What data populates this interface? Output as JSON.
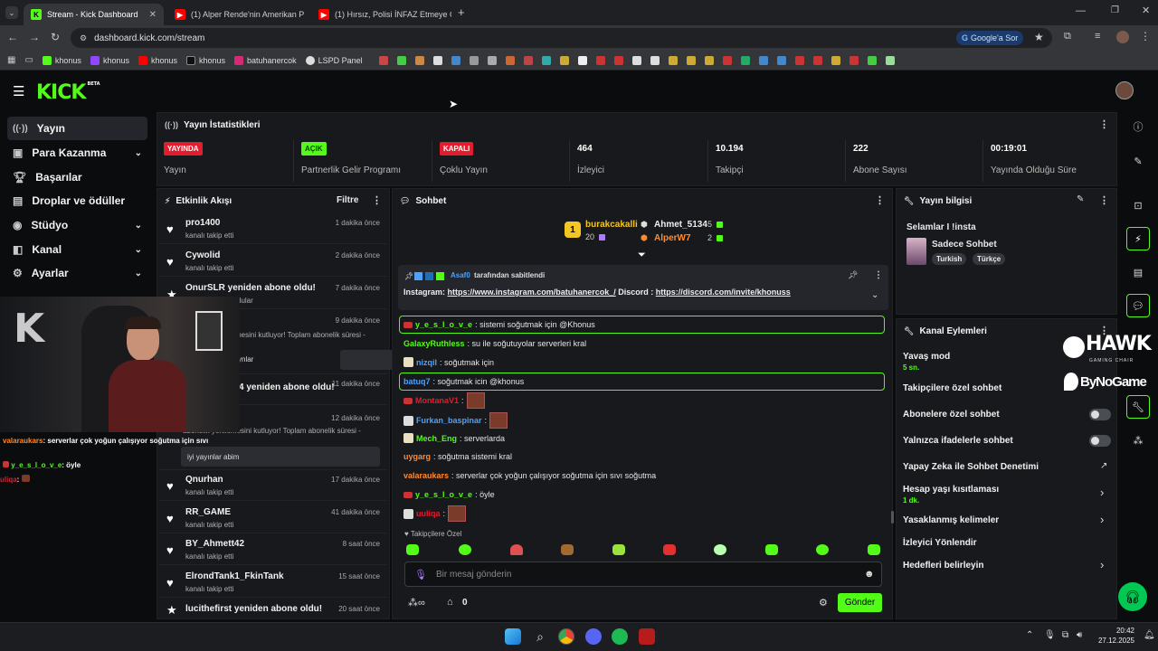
{
  "browser": {
    "tabs": [
      {
        "title": "Stream - Kick Dashboard",
        "favicon": "kick"
      },
      {
        "title": "(1) Alper Rende'nin Amerikan P",
        "favicon": "youtube"
      },
      {
        "title": "(1) Hırsız, Polisi İNFAZ Etmeye Ç",
        "favicon": "youtube"
      }
    ],
    "url": "dashboard.kick.com/stream",
    "google_button": "Google'a Sor",
    "bookmarks": [
      "khonus",
      "khonus",
      "khonus",
      "khonus",
      "batuhanercok",
      "LSPD Panel"
    ]
  },
  "kick": {
    "logo": "KICK",
    "logo_beta": "BETA"
  },
  "sidebar": {
    "items": [
      {
        "label": "Yayın",
        "icon": "broadcast-icon"
      },
      {
        "label": "Para Kazanma",
        "icon": "money-icon"
      },
      {
        "label": "Başarılar",
        "icon": "trophy-icon"
      },
      {
        "label": "Droplar ve ödüller",
        "icon": "gift-icon"
      },
      {
        "label": "Stüdyo",
        "icon": "studio-icon"
      },
      {
        "label": "Kanal",
        "icon": "channel-icon"
      },
      {
        "label": "Ayarlar",
        "icon": "gear-icon"
      }
    ]
  },
  "stats": {
    "title": "Yayın İstatistikleri",
    "items": [
      {
        "value": "YAYINDA",
        "label": "Yayın",
        "color": "#e11d2e"
      },
      {
        "value": "AÇIK",
        "label": "Partnerlik Gelir Programı",
        "color": "#53fc18"
      },
      {
        "value": "KAPALI",
        "label": "Çoklu Yayın",
        "color": "#e11d2e"
      },
      {
        "value": "464",
        "label": "İzleyici"
      },
      {
        "value": "10.194",
        "label": "Takipçi"
      },
      {
        "value": "222",
        "label": "Abone Sayısı"
      },
      {
        "value": "00:19:01",
        "label": "Yayında Olduğu Süre"
      }
    ]
  },
  "events": {
    "title": "Etkinlik Akışı",
    "filter": "Filtre",
    "items": [
      {
        "name": "pro1400",
        "sub": "kanalı takip etti",
        "time": "1 dakika önce"
      },
      {
        "name": "Cywolid",
        "sub": "kanalı takip etti",
        "time": "2 dakika önce"
      },
      {
        "name": "OnurSLR yeniden abone oldu!",
        "sub": "dular",
        "time": "7 dakika önce"
      },
      {
        "name": "",
        "sub": "mesini kutluyor! Toplam abonelik süresi -",
        "time": "9 dakika önce",
        "message": "ynlar"
      },
      {
        "name": "4 yeniden abone oldu!",
        "sub": "",
        "time": "11 dakika önce"
      },
      {
        "name": "",
        "sub": "abonelik yenilemesini kutluyor! Toplam abonelik süresi -",
        "time": "12 dakika önce",
        "message": "iyi yayınlar abim"
      },
      {
        "name": "Qnurhan",
        "sub": "kanalı takip etti",
        "time": "17 dakika önce"
      },
      {
        "name": "RR_GAME",
        "sub": "kanalı takip etti",
        "time": "41 dakika önce"
      },
      {
        "name": "BY_Ahmett42",
        "sub": "kanalı takip etti",
        "time": "8 saat önce"
      },
      {
        "name": "ElrondTank1_FkinTank",
        "sub": "kanalı takip etti",
        "time": "15 saat önce"
      },
      {
        "name": "lucithefirst yeniden abone oldu!",
        "sub": "",
        "time": "20 saat önce"
      }
    ]
  },
  "chat": {
    "title": "Sohbet",
    "leaderboard": {
      "top": {
        "name": "burakcakalli",
        "count": "20"
      },
      "second": {
        "name": "Ahmet_5134",
        "count": "5"
      },
      "third": {
        "name": "AlperW7",
        "count": "2"
      }
    },
    "pinned": {
      "by": "Asaf0",
      "suffix": "tarafından sabitlendi",
      "prefix_text": "Instagram: ",
      "link1": "https://www.instagram.com/batuhanercok_/",
      "middle": " Discord : ",
      "link2": "https://discord.com/invite/khonuss"
    },
    "messages": [
      {
        "user": "y_e_s_l_o_v_e",
        "text": ": sistemi soğutmak için @Khonus",
        "color": "#53fc18"
      },
      {
        "user": "GalaxyRuthless",
        "text": ": su ile soğutuyolar serverleri kral",
        "color": "#53fc18"
      },
      {
        "user": "nizqil",
        "text": ": soğutmak için",
        "color": "#4aa3ff"
      },
      {
        "user": "batuq7",
        "text": ": soğutmak icin @khonus",
        "color": "#4aa3ff"
      },
      {
        "user": "MontanaV1",
        "text": ":",
        "color": "#e11d2e"
      },
      {
        "user": "Furkan_baspinar",
        "text": ":",
        "color": "#4aa3ff"
      },
      {
        "user": "Mech_Eng",
        "text": ": serverlarda",
        "color": "#53fc18"
      },
      {
        "user": "uygarg",
        "text": ": soğutma sistemi kral",
        "color": "#ff8a30"
      },
      {
        "user": "valaraukars",
        "text": ": serverlar çok yoğun çalışıyor soğutma için sıvı soğutma",
        "color": "#ff8a30"
      },
      {
        "user": "y_e_s_l_o_v_e",
        "text": ": öyle",
        "color": "#53fc18"
      },
      {
        "user": "uuliqa",
        "text": ":",
        "color": "#e11d2e"
      }
    ],
    "followers_only": "Takipçilere Özel",
    "input_placeholder": "Bir mesaj gönderin",
    "points": "0",
    "send": "Gönder"
  },
  "overlay_chat": [
    {
      "user": "valaraukars",
      "text": ": serverlar çok yoğun çalışıyor soğutma için sıvı"
    },
    {
      "user": "y_e_s_l_o_v_e",
      "text": ": öyle"
    },
    {
      "user": "uliqa",
      "text": ":"
    }
  ],
  "stream_info": {
    "title": "Yayın bilgisi",
    "stream_title": "Selamlar I !insta",
    "category": "Sadece Sohbet",
    "tags": [
      "Turkish",
      "Türkçe"
    ]
  },
  "channel_actions": {
    "title": "Kanal Eylemleri",
    "slow_mode": "Yavaş mod",
    "slow_mode_value": "5 sn.",
    "followers_chat": "Takipçilere özel sohbet",
    "subscribers_chat": "Abonelere özel sohbet",
    "emote_only": "Yalnızca ifadelerle sohbet",
    "ai_moderation": "Yapay Zeka ile Sohbet Denetimi",
    "account_age": "Hesap yaşı kısıtlaması",
    "account_age_value": "1 dk.",
    "banned_words": "Yasaklanmış kelimeler",
    "viewer_redirect": "İzleyici Yönlendir",
    "goals": "Hedefleri belirleyin"
  },
  "sponsor": {
    "brand": "HAWK",
    "brand_sub": "GAMING CHAIR",
    "partner": "ByNoGame"
  },
  "taskbar": {
    "time": "20:42",
    "date": "27.12.2025"
  }
}
